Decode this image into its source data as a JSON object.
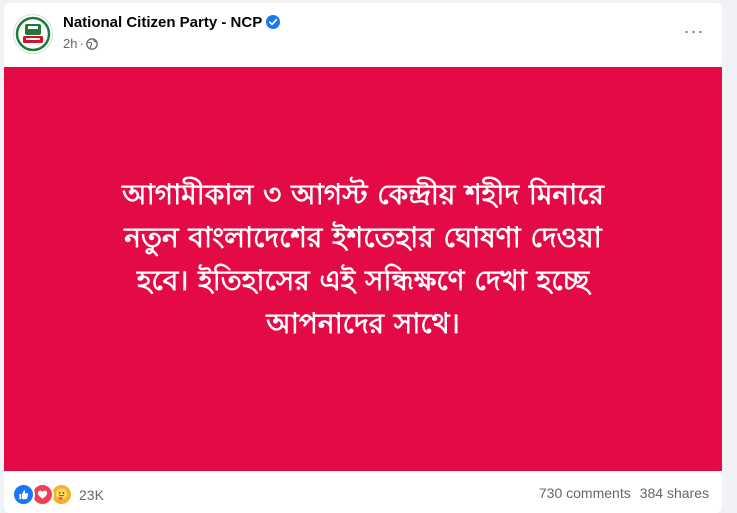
{
  "post": {
    "page_name": "National Citizen Party - NCP",
    "timestamp": "2h",
    "meta_separator": "·",
    "verified": true,
    "avatar_icon": "ncp-logo-icon",
    "privacy_icon": "globe-icon",
    "more_icon": "more-options-icon",
    "more_label": "···"
  },
  "post_image": {
    "background_color": "#e40a46",
    "text_color": "#ffffff",
    "lines": [
      "আগামীকাল ৩ আগস্ট কেন্দ্রীয় শহীদ মিনারে",
      "নতুন বাংলাদেশের ইশতেহার ঘোষণা দেওয়া",
      "হবে। ইতিহাসের এই সন্ধিক্ষণে দেখা হচ্ছে",
      "আপনাদের সাথে।"
    ]
  },
  "stats": {
    "reaction_icons": [
      "like-icon",
      "love-icon",
      "care-icon"
    ],
    "reaction_count": "23K",
    "comments": "730 comments",
    "shares": "384 shares"
  },
  "colors": {
    "brand_blue": "#1877f2",
    "secondary_text": "#65676b",
    "primary_text": "#050505"
  }
}
